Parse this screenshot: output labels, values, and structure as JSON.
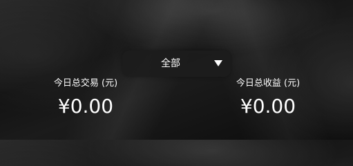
{
  "filter": {
    "label": "全部",
    "icon": "caret-down-icon"
  },
  "stats": [
    {
      "label": "今日总交易 (元)",
      "value": "¥0.00"
    },
    {
      "label": "今日总收益 (元)",
      "value": "¥0.00"
    }
  ],
  "colors": {
    "text": "#ffffff",
    "dropdown_bg": "#1c1c1c"
  }
}
